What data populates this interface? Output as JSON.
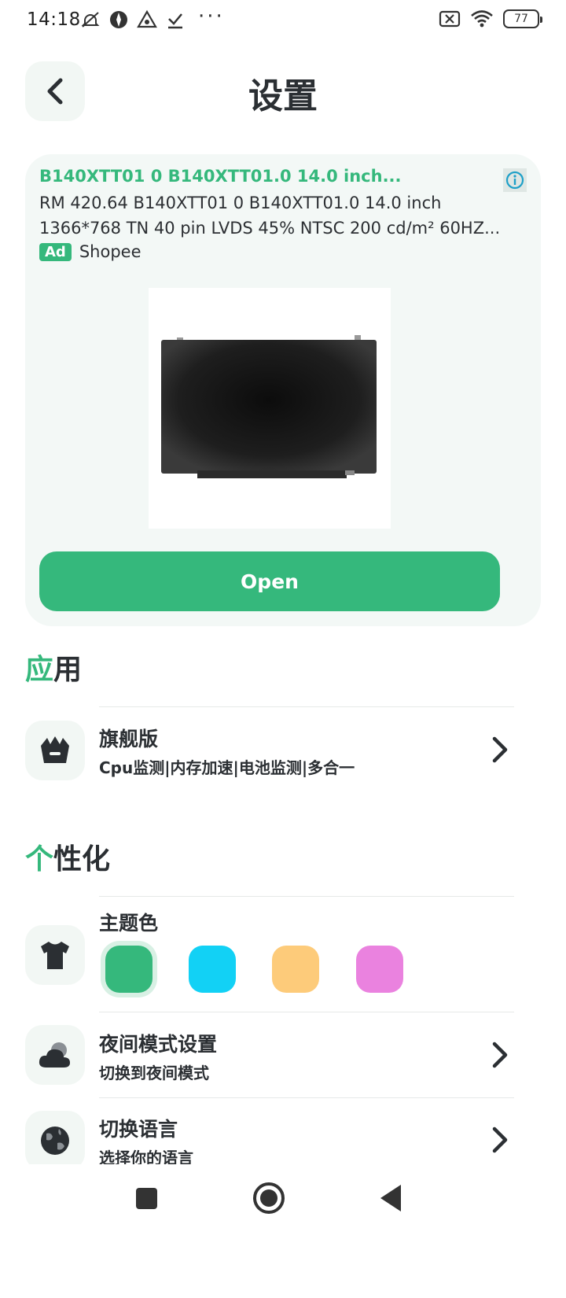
{
  "status_bar": {
    "time": "14:18",
    "battery": "77",
    "more": "···",
    "icons": [
      "mute-icon",
      "app-icon",
      "app-icon",
      "check-icon",
      "sim-off-icon",
      "wifi-icon",
      "battery-icon"
    ]
  },
  "header": {
    "title": "设置",
    "back_icon": "chevron-left-icon"
  },
  "ad": {
    "title": "B140XTT01 0 B140XTT01.0 14.0 inch...",
    "desc_line1": "RM 420.64 B140XTT01 0 B140XTT01.0 14.0 inch",
    "desc_line2": "1366*768 TN 40 pin LVDS 45% NTSC 200 cd/m² 60HZ...",
    "badge": "Ad",
    "brand": "Shopee",
    "cta": "Open",
    "image_alt": "laptop-screen-panel"
  },
  "sections": {
    "apps": {
      "accent": "应",
      "rest": "用"
    },
    "personalize": {
      "accent": "个",
      "rest": "性化"
    }
  },
  "rows": {
    "premium": {
      "title": "旗舰版",
      "subtitle": "Cpu监测|内存加速|电池监测|多合一",
      "icon": "crown-basket-icon"
    },
    "theme": {
      "title": "主题色",
      "icon": "tshirt-icon"
    },
    "night": {
      "title": "夜间模式设置",
      "subtitle": "切换到夜间模式",
      "icon": "cloud-moon-icon"
    },
    "language": {
      "title": "切换语言",
      "subtitle": "选择你的语言",
      "icon": "globe-icon"
    }
  },
  "theme_colors": {
    "green": "#35b87c",
    "cyan": "#12d1f5",
    "orange": "#fdcb7a",
    "pink": "#ea82df",
    "selected": "green"
  },
  "colors": {
    "accent": "#35b87c",
    "text": "#2b2f33",
    "tile_bg": "#f2f7f4"
  }
}
